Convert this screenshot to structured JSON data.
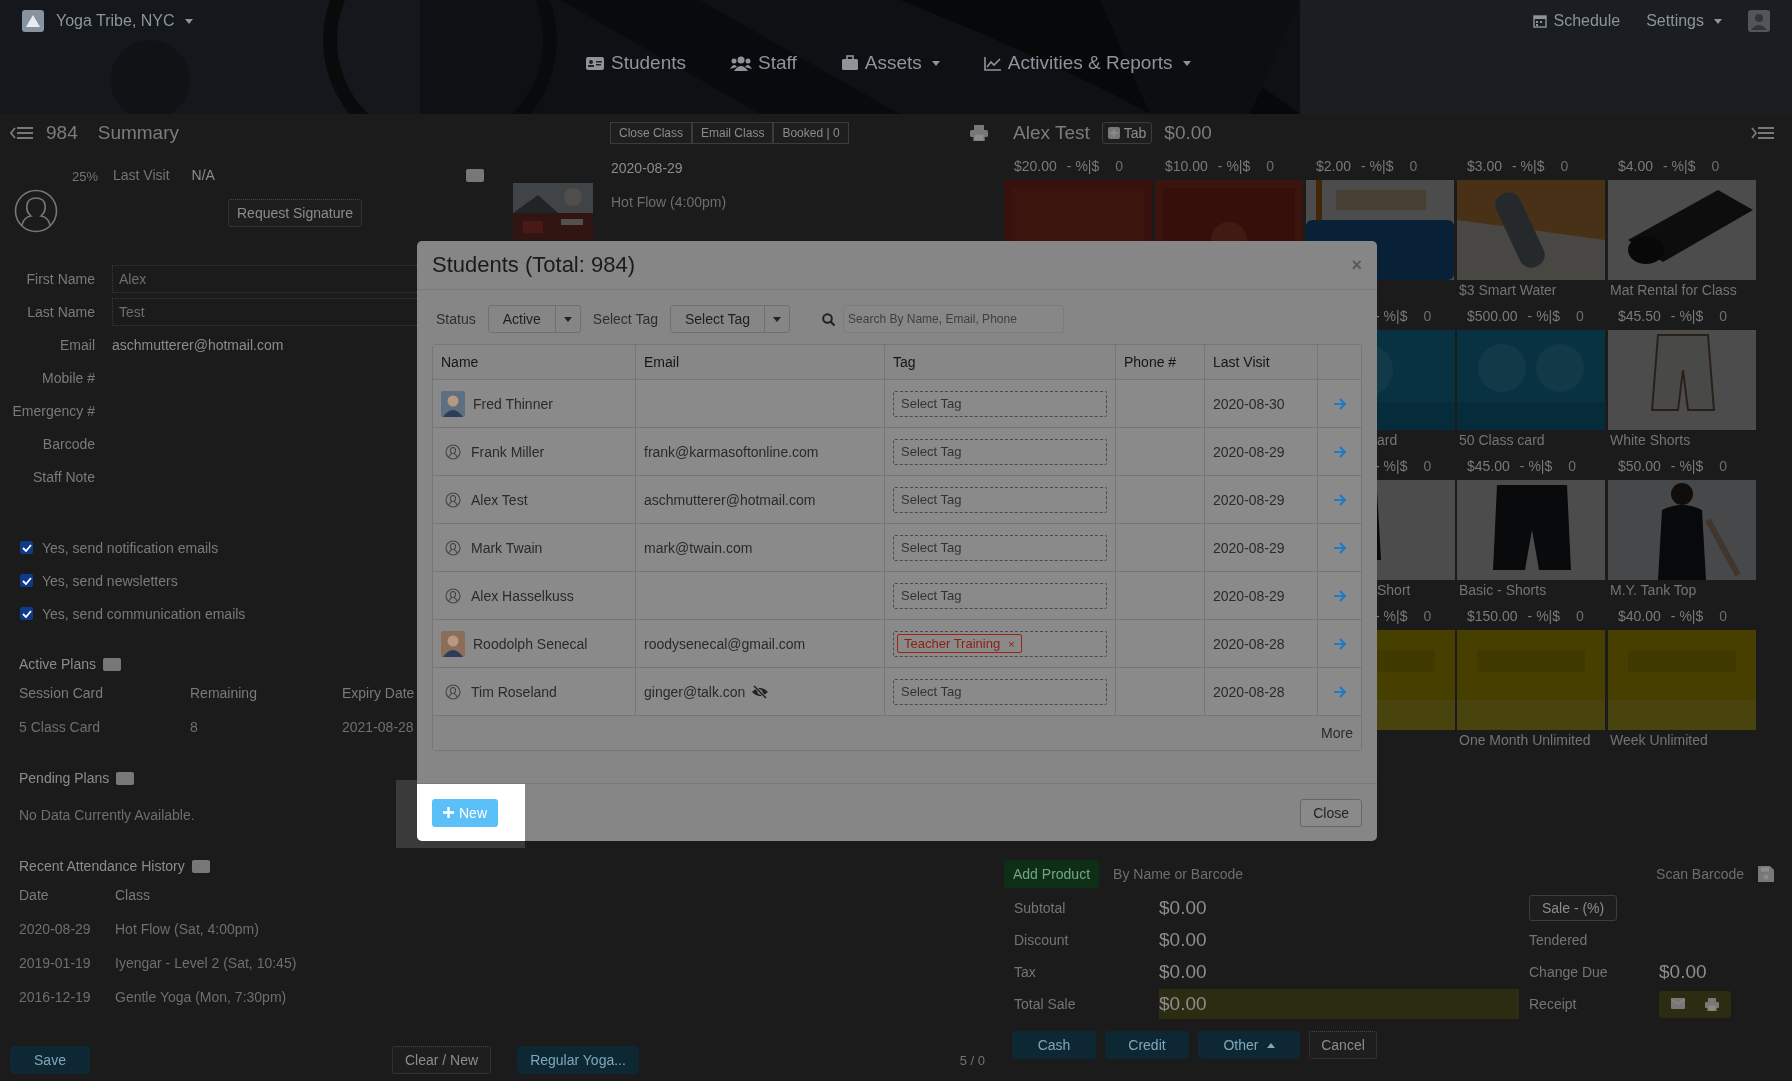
{
  "header": {
    "brand": "Yoga Tribe, NYC",
    "nav": [
      {
        "label": "Students",
        "dropdown": false
      },
      {
        "label": "Staff",
        "dropdown": false
      },
      {
        "label": "Assets",
        "dropdown": true
      },
      {
        "label": "Activities & Reports",
        "dropdown": true
      }
    ],
    "links": [
      {
        "label": "Schedule",
        "dropdown": false
      },
      {
        "label": "Settings",
        "dropdown": true
      }
    ]
  },
  "profile": {
    "count": "984",
    "title": "Summary",
    "completion": "25%",
    "last_visit_label": "Last Visit",
    "last_visit": "N/A",
    "signature_button": "Request Signature",
    "fields": [
      {
        "label": "First Name",
        "kind": "input",
        "placeholder": "Alex"
      },
      {
        "label": "Last Name",
        "kind": "input",
        "placeholder": "Test"
      },
      {
        "label": "Email",
        "kind": "text",
        "value": "aschmutterer@hotmail.com"
      },
      {
        "label": "Mobile #",
        "kind": "text"
      },
      {
        "label": "Emergency #",
        "kind": "text"
      },
      {
        "label": "Barcode",
        "kind": "text"
      },
      {
        "label": "Staff Note",
        "kind": "text"
      }
    ],
    "options": [
      {
        "label": "Yes, send notification emails",
        "checked": true
      },
      {
        "label": "Yes, send newsletters",
        "checked": true
      },
      {
        "label": "Yes, send communication emails",
        "checked": true
      }
    ],
    "active_plans": {
      "title": "Active Plans",
      "columns": [
        "Session Card",
        "Remaining",
        "Expiry Date"
      ],
      "rows": [
        [
          "5 Class Card",
          "8",
          "2021-08-28"
        ]
      ]
    },
    "pending_plans": {
      "title": "Pending Plans",
      "empty": "No Data Currently Available."
    },
    "attendance": {
      "title": "Recent Attendance History",
      "columns": [
        "Date",
        "Class"
      ],
      "rows": [
        [
          "2020-08-29",
          "Hot Flow (Sat, 4:00pm)"
        ],
        [
          "2019-01-19",
          "Iyengar - Level 2 (Sat, 10:45)"
        ],
        [
          "2016-12-19",
          "Gentle Yoga (Mon, 7:30pm)"
        ]
      ]
    },
    "save_button": "Save",
    "clear_button": "Clear / New",
    "replace_button": "Regular Yoga..."
  },
  "class_panel": {
    "buttons": [
      "Close Class",
      "Email Class",
      "Booked | 0"
    ],
    "date": "2020-08-29",
    "class_name": "Hot Flow (4:00pm)",
    "pager": "5 / 0"
  },
  "pos": {
    "customer": "Alex Test",
    "tab_button": "Tab",
    "balance": "$0.00",
    "products": [
      [
        {
          "kind": "full",
          "price": "$20.00",
          "discount": "- %|$",
          "qty": "0"
        },
        {
          "kind": "full",
          "price": "$10.00",
          "discount": "- %|$",
          "qty": "0"
        },
        {
          "kind": "full",
          "price": "$2.00",
          "discount": "- %|$",
          "qty": "0"
        },
        {
          "kind": "full",
          "price": "$3.00",
          "discount": "- %|$",
          "qty": "0",
          "name": "$3 Smart Water"
        },
        {
          "kind": "full",
          "price": "$4.00",
          "discount": "- %|$",
          "qty": "0",
          "name": "Mat Rental for Class"
        }
      ],
      [
        {
          "kind": "partial",
          "discount": "- %|$",
          "qty": "0",
          "name": "ard"
        },
        {
          "kind": "full",
          "price": "$500.00",
          "discount": "- %|$",
          "qty": "0",
          "name": "50 Class card"
        },
        {
          "kind": "full",
          "price": "$45.50",
          "discount": "- %|$",
          "qty": "0",
          "name": "White Shorts"
        }
      ],
      [
        {
          "kind": "partial",
          "discount": "- %|$",
          "qty": "0",
          "name": "Short"
        },
        {
          "kind": "full",
          "price": "$45.00",
          "discount": "- %|$",
          "qty": "0",
          "name": "Basic - Shorts"
        },
        {
          "kind": "full",
          "price": "$50.00",
          "discount": "- %|$",
          "qty": "0",
          "name": "M.Y. Tank Top"
        }
      ],
      [
        {
          "kind": "partial",
          "discount": "- %|$",
          "qty": "0"
        },
        {
          "kind": "full",
          "price": "$150.00",
          "discount": "- %|$",
          "qty": "0",
          "name": "One Month Unlimited"
        },
        {
          "kind": "full",
          "price": "$40.00",
          "discount": "- %|$",
          "qty": "0",
          "name": "Week Unlimited"
        }
      ]
    ],
    "add_product": "Add Product",
    "search_placeholder": "By Name or Barcode",
    "scan_placeholder": "Scan Barcode",
    "totals": [
      {
        "label": "Subtotal",
        "value": "$0.00",
        "highlighted": false
      },
      {
        "label": "Discount",
        "value": "$0.00",
        "highlighted": false
      },
      {
        "label": "Tax",
        "value": "$0.00",
        "highlighted": false
      },
      {
        "label": "Total Sale",
        "value": "$0.00",
        "highlighted": true
      }
    ],
    "sale_button": "Sale - (%)",
    "tendered_label": "Tendered",
    "change_label": "Change Due",
    "change": "$0.00",
    "receipt_label": "Receipt",
    "payments": [
      {
        "label": "Cash",
        "dropdown": false
      },
      {
        "label": "Credit",
        "dropdown": false
      },
      {
        "label": "Other",
        "dropdown": true
      }
    ],
    "cancel_button": "Cancel"
  },
  "modal": {
    "title": "Students (Total: 984)",
    "close": "×",
    "status_label": "Status",
    "status": "Active",
    "tag_label": "Select Tag",
    "tag_filter": "Select Tag",
    "search_placeholder": "Search By Name, Email, Phone",
    "columns": [
      "Name",
      "Email",
      "Tag",
      "Phone #",
      "Last Visit"
    ],
    "rows": [
      {
        "name": "Fred Thinner",
        "email_blocked": false,
        "tags": [],
        "tag_placeholder": "Select Tag",
        "last_visit": "2020-08-30"
      },
      {
        "kind": "default",
        "name": "Frank Miller",
        "email": "frank@karmasoftonline.com",
        "email_blocked": false,
        "tags": [],
        "tag_placeholder": "Select Tag",
        "last_visit": "2020-08-29"
      },
      {
        "kind": "default",
        "name": "Alex Test",
        "email": "aschmutterer@hotmail.com",
        "email_blocked": false,
        "tags": [],
        "tag_placeholder": "Select Tag",
        "last_visit": "2020-08-29"
      },
      {
        "kind": "default",
        "name": "Mark Twain",
        "email": "mark@twain.com",
        "email_blocked": false,
        "tags": [],
        "tag_placeholder": "Select Tag",
        "last_visit": "2020-08-29"
      },
      {
        "kind": "default",
        "name": "Alex Hasselkuss",
        "email_blocked": false,
        "tags": [],
        "tag_placeholder": "Select Tag",
        "last_visit": "2020-08-29"
      },
      {
        "name": "Roodolph Senecal",
        "email": "roodysenecal@gmail.com",
        "email_blocked": false,
        "tags": [
          {
            "label": "Teacher Training",
            "remove": "×"
          }
        ],
        "last_visit": "2020-08-28"
      },
      {
        "kind": "default",
        "name": "Tim Roseland",
        "email": "ginger@talk.con",
        "email_blocked": true,
        "tags": [],
        "tag_placeholder": "Select Tag",
        "last_visit": "2020-08-28"
      }
    ],
    "more": "More",
    "new_button": "New",
    "close_button": "Close",
    "spotlight": true
  }
}
